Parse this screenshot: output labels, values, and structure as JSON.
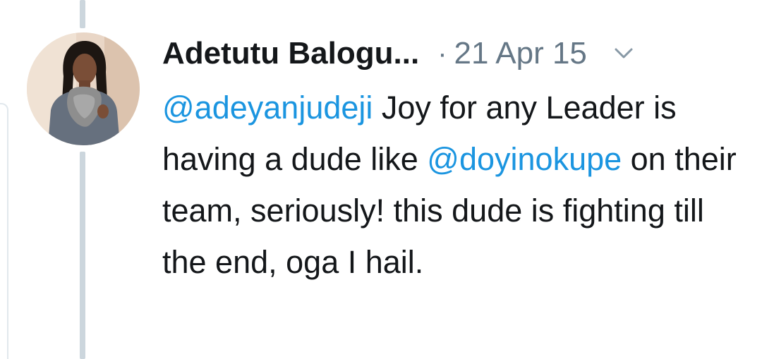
{
  "tweet": {
    "author_name": "Adetutu Balogu...",
    "separator": "·",
    "timestamp": "21 Apr 15",
    "menu_icon": "chevron-down-icon",
    "text_parts": [
      {
        "type": "mention",
        "text": "@adeyanjudeji"
      },
      {
        "type": "text",
        "text": " Joy for any Leader is having a dude like "
      },
      {
        "type": "mention",
        "text": "@doyinokupe"
      },
      {
        "type": "text",
        "text": " on their team, seriously! this dude is fighting till the end, oga I hail."
      }
    ]
  },
  "colors": {
    "mention": "#1b95e0",
    "meta_text": "#657786",
    "body_text": "#14171a",
    "thread_line": "#ccd6dd"
  }
}
